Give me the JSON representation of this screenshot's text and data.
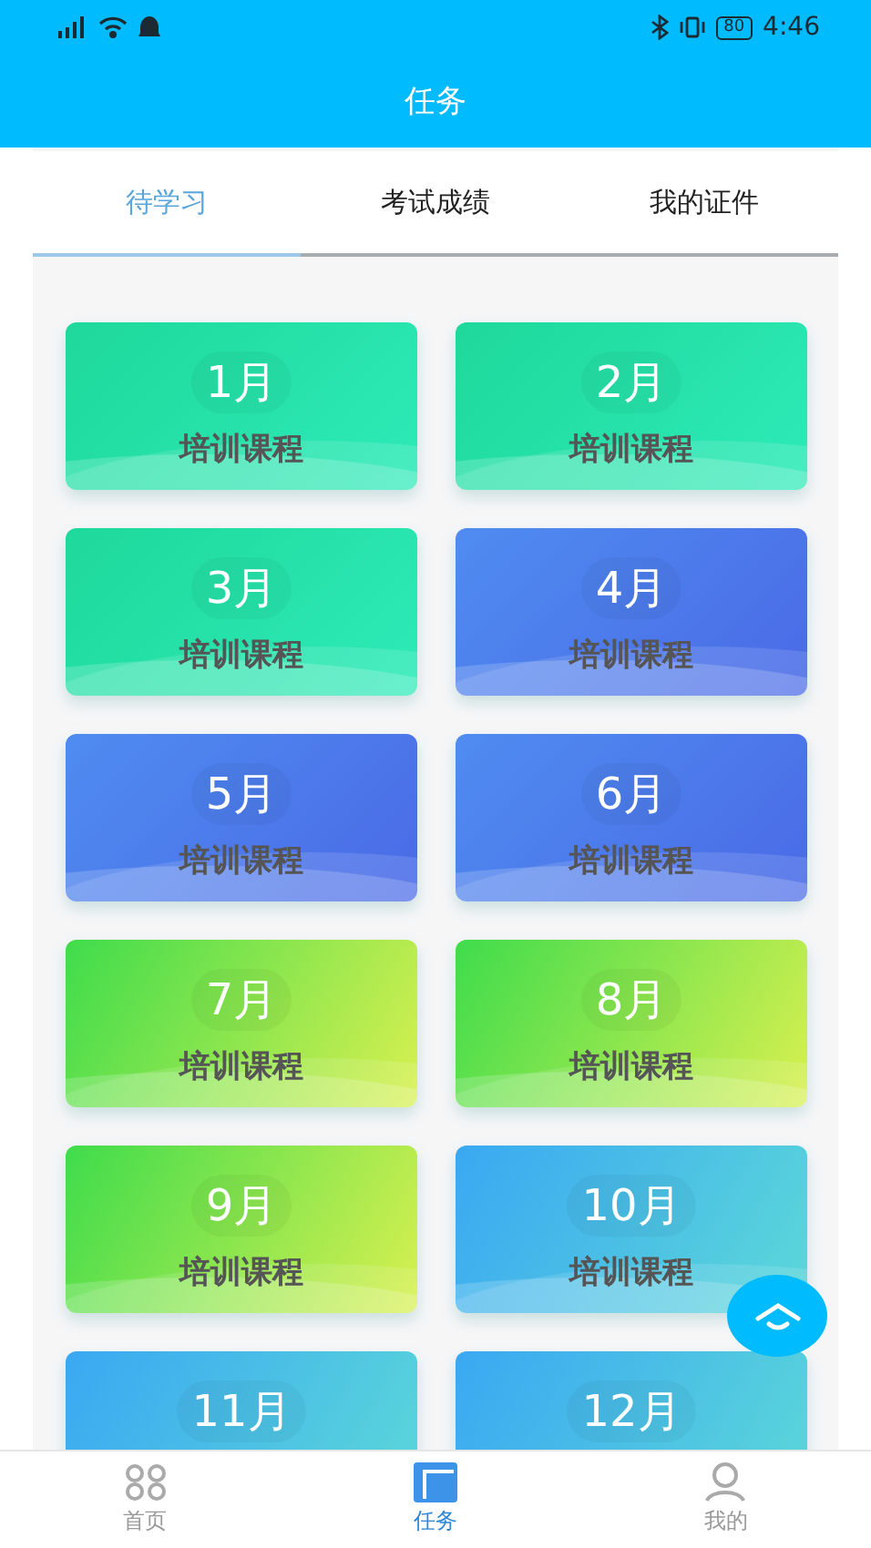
{
  "status_bar": {
    "battery": "80",
    "time": "4:46"
  },
  "header": {
    "title": "任务"
  },
  "tabs": [
    {
      "label": "待学习",
      "selected": true
    },
    {
      "label": "考试成绩",
      "selected": false
    },
    {
      "label": "我的证件",
      "selected": false
    }
  ],
  "cards": [
    {
      "month": "1月",
      "label": "培训课程",
      "kind": "green"
    },
    {
      "month": "2月",
      "label": "培训课程",
      "kind": "green"
    },
    {
      "month": "3月",
      "label": "培训课程",
      "kind": "green"
    },
    {
      "month": "4月",
      "label": "培训课程",
      "kind": "blue"
    },
    {
      "month": "5月",
      "label": "培训课程",
      "kind": "blue"
    },
    {
      "month": "6月",
      "label": "培训课程",
      "kind": "blue"
    },
    {
      "month": "7月",
      "label": "培训课程",
      "kind": "lime"
    },
    {
      "month": "8月",
      "label": "培训课程",
      "kind": "lime"
    },
    {
      "month": "9月",
      "label": "培训课程",
      "kind": "lime"
    },
    {
      "month": "10月",
      "label": "培训课程",
      "kind": "sky"
    },
    {
      "month": "11月",
      "kind": "sky"
    },
    {
      "month": "12月",
      "kind": "sky"
    }
  ],
  "bottom_nav": [
    {
      "label": "首页",
      "kind": "grid",
      "selected": false
    },
    {
      "label": "任务",
      "kind": "tasks",
      "selected": true
    },
    {
      "label": "我的",
      "kind": "user",
      "selected": false
    }
  ]
}
